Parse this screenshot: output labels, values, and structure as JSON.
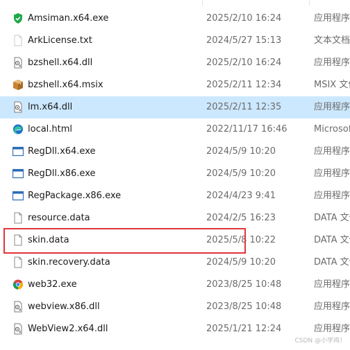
{
  "files": [
    {
      "name": "Amsiman.x64.exe",
      "date": "2025/2/10 16:24",
      "type": "应用程序",
      "icon": "shield-exe-icon"
    },
    {
      "name": "ArkLicense.txt",
      "date": "2024/5/27 15:13",
      "type": "文本文档",
      "icon": "text-file-icon"
    },
    {
      "name": "bzshell.x64.dll",
      "date": "2025/2/10 16:24",
      "type": "应用程序",
      "icon": "dll-file-icon"
    },
    {
      "name": "bzshell.x64.msix",
      "date": "2025/2/11 12:34",
      "type": "MSIX 文件",
      "icon": "package-icon"
    },
    {
      "name": "lm.x64.dll",
      "date": "2025/2/11 12:35",
      "type": "应用程序",
      "icon": "dll-file-icon"
    },
    {
      "name": "local.html",
      "date": "2022/11/17 16:46",
      "type": "Microsoft",
      "icon": "edge-html-icon"
    },
    {
      "name": "RegDll.x64.exe",
      "date": "2024/5/9 10:20",
      "type": "应用程序",
      "icon": "window-exe-icon"
    },
    {
      "name": "RegDll.x86.exe",
      "date": "2024/5/9 10:20",
      "type": "应用程序",
      "icon": "window-exe-icon"
    },
    {
      "name": "RegPackage.x86.exe",
      "date": "2024/4/23 9:41",
      "type": "应用程序",
      "icon": "window-exe-icon"
    },
    {
      "name": "resource.data",
      "date": "2024/2/5 16:23",
      "type": "DATA 文件",
      "icon": "blank-file-icon"
    },
    {
      "name": "skin.data",
      "date": "2025/5/8 10:22",
      "type": "DATA 文件",
      "icon": "blank-file-icon"
    },
    {
      "name": "skin.recovery.data",
      "date": "2024/5/9 10:20",
      "type": "DATA 文件",
      "icon": "blank-file-icon"
    },
    {
      "name": "web32.exe",
      "date": "2023/8/25 10:48",
      "type": "应用程序",
      "icon": "chrome-exe-icon"
    },
    {
      "name": "webview.x86.dll",
      "date": "2023/8/25 10:48",
      "type": "应用程序",
      "icon": "dll-file-icon"
    },
    {
      "name": "WebView2.x64.dll",
      "date": "2025/1/21 12:24",
      "type": "应用程序",
      "icon": "dll-file-icon"
    }
  ],
  "selected_index": 4,
  "highlighted_index": 10,
  "colors": {
    "selection": "#cce8ff",
    "highlight_border": "#e0353b",
    "date_text": "#6b6b6b"
  },
  "watermark": "CSDN @小学鸡！"
}
